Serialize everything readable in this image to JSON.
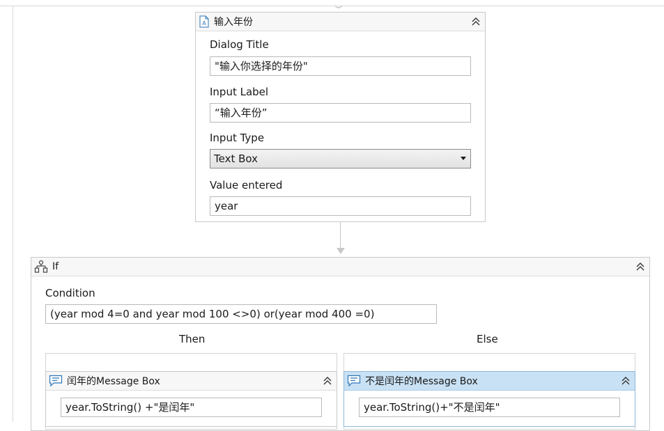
{
  "input_dialog": {
    "title": "输入年份",
    "dialog_title_label": "Dialog Title",
    "dialog_title_value": "\"输入你选择的年份\"",
    "input_label_label": "Input Label",
    "input_label_value": "“输入年份”",
    "input_type_label": "Input Type",
    "input_type_value": "Text Box",
    "value_entered_label": "Value entered",
    "value_entered_value": "year"
  },
  "if_activity": {
    "title": "If",
    "condition_label": "Condition",
    "condition_value": "(year mod 4=0 and year mod 100 <>0) or(year mod 400 =0)",
    "then_label": "Then",
    "else_label": "Else",
    "then_message": {
      "title": "闰年的Message Box",
      "text": "year.ToString()  +\"是闰年\""
    },
    "else_message": {
      "title": "不是闰年的Message Box",
      "text": "year.ToString()+\"不是闰年\""
    }
  },
  "colors": {
    "selected_header": "#c9e1f4",
    "icon_blue": "#2e75b6"
  },
  "icons": {
    "input_dialog": "input-dialog-icon",
    "if": "if-icon",
    "message_box": "message-box-icon",
    "collapse": "collapse-chevrons-icon"
  }
}
